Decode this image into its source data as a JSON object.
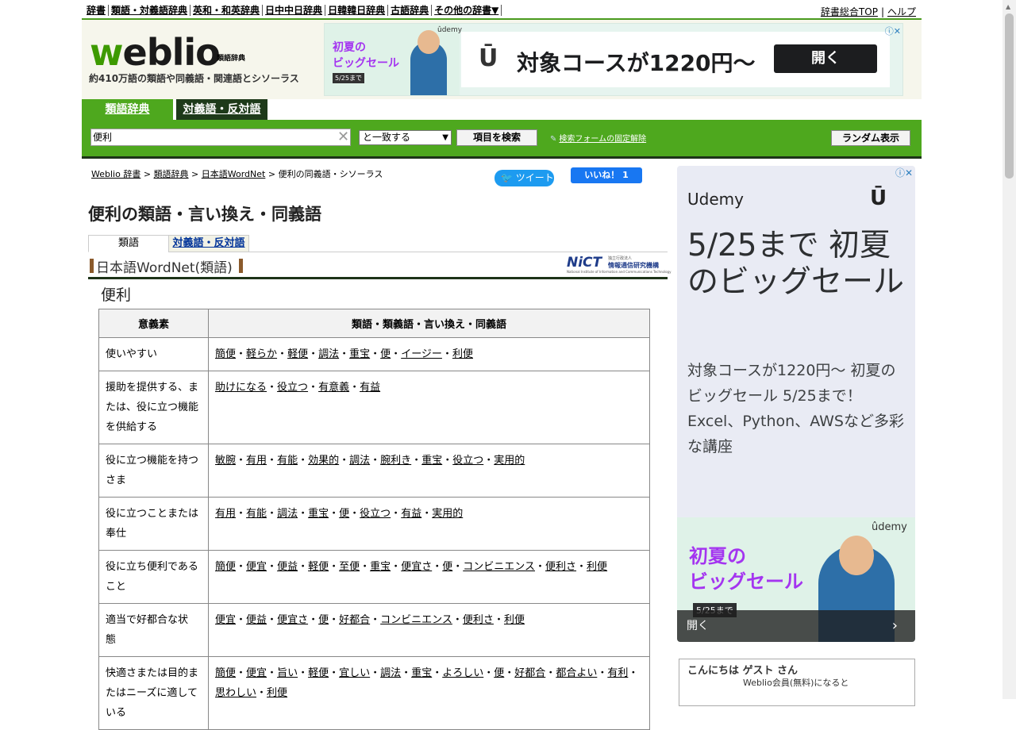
{
  "topnav": {
    "items": [
      "辞書",
      "類語・対義語辞典",
      "英和・和英辞典",
      "日中中日辞典",
      "日韓韓日辞典",
      "古語辞典",
      "その他の辞書▼"
    ],
    "right": [
      "辞書総合TOP",
      "ヘルプ"
    ],
    "separator": "|"
  },
  "header": {
    "logo_w": "w",
    "logo_rest": "eblio",
    "logo_sub": "類語辞典",
    "tagline": "約410万語の類語や同義語・関連語とシソーラス"
  },
  "top_ad": {
    "left_title_1": "初夏の",
    "left_title_2": "ビッグセール",
    "date": "5/25まで",
    "brand": "ûdemy",
    "headline": "対象コースが1220円〜",
    "button": "開く",
    "ad_icons": "ⓘ✕"
  },
  "tabs": {
    "synonyms": "類語辞典",
    "antonyms": "対義語・反対語"
  },
  "search": {
    "value": "便利",
    "clear": "✕",
    "mode": "と一致する",
    "mode_arrow": "▼",
    "button": "項目を検索",
    "fix_link": "検索フォームの固定解除",
    "fix_icon": "✎",
    "random": "ランダム表示"
  },
  "breadcrumb": {
    "items": [
      "Weblio 辞書",
      "類語辞典",
      "日本語WordNet"
    ],
    "sep": ">",
    "current": "便利の同義語・シソーラス"
  },
  "social": {
    "tweet": "ツイート",
    "tweet_icon": "🐦",
    "like": "いいね！ 1"
  },
  "page": {
    "title": "便利の類語・言い換え・同義語",
    "subtab_1": "類語",
    "subtab_2": "対義語・反対語",
    "dict_name": "日本語WordNet(類語)",
    "nict_logo": "NiCT",
    "nict_sub1": "独立行政法人",
    "nict_sub2": "情報通信研究機構",
    "nict_sub3": "National Institute of Information and Communications Technology",
    "headword": "便利"
  },
  "table": {
    "col1": "意義素",
    "col2": "類語・類義語・言い換え・同義語",
    "rows": [
      {
        "meaning": [
          "使いやすい"
        ],
        "synonyms": [
          "簡便",
          "軽らか",
          "軽便",
          "調法",
          "重宝",
          "便",
          "イージー",
          "利便"
        ]
      },
      {
        "meaning": [
          "援助を提供する、ま",
          "たは、役に立つ機能",
          "を供給する"
        ],
        "synonyms": [
          "助けになる",
          "役立つ",
          "有意義",
          "有益"
        ]
      },
      {
        "meaning": [
          "役に立つ機能を持つ",
          "さま"
        ],
        "synonyms": [
          "敏腕",
          "有用",
          "有能",
          "効果的",
          "調法",
          "腕利き",
          "重宝",
          "役立つ",
          "実用的"
        ]
      },
      {
        "meaning": [
          "役に立つことまたは",
          "奉仕"
        ],
        "synonyms": [
          "有用",
          "有能",
          "調法",
          "重宝",
          "便",
          "役立つ",
          "有益",
          "実用的"
        ]
      },
      {
        "meaning": [
          "役に立ち便利である",
          "こと"
        ],
        "synonyms": [
          "簡便",
          "便宜",
          "便益",
          "軽便",
          "至便",
          "重宝",
          "便宜さ",
          "便",
          "コンビニエンス",
          "便利さ",
          "利便"
        ]
      },
      {
        "meaning": [
          "適当で好都合な状",
          "態"
        ],
        "synonyms": [
          "便宜",
          "便益",
          "便宜さ",
          "便",
          "好都合",
          "コンビニエンス",
          "便利さ",
          "利便"
        ]
      },
      {
        "meaning": [
          "快適さまたは目的ま",
          "たはニーズに適して",
          "いる"
        ],
        "synonyms": [
          "簡便",
          "便宜",
          "旨い",
          "軽便",
          "宜しい",
          "調法",
          "重宝",
          "よろしい",
          "便",
          "好都合",
          "都合よい",
          "有利",
          "思わしい",
          "利便"
        ]
      }
    ]
  },
  "side_ad": {
    "brand": "Udemy",
    "big": "5/25まで 初夏のビッグセール",
    "small": "対象コースが1220円〜 初夏のビッグセール 5/25まで！ Excel、Python、AWSなど多彩な講座",
    "lower_title_1": "初夏の",
    "lower_title_2": "ビッグセール",
    "lower_brand": "ûdemy",
    "date": "5/25まで",
    "open": "開く",
    "chev": "›",
    "ad_icons": "ⓘ✕"
  },
  "welcome": {
    "greeting": "こんにちは ゲスト さん",
    "register": "Weblio会員(無料)になると"
  }
}
